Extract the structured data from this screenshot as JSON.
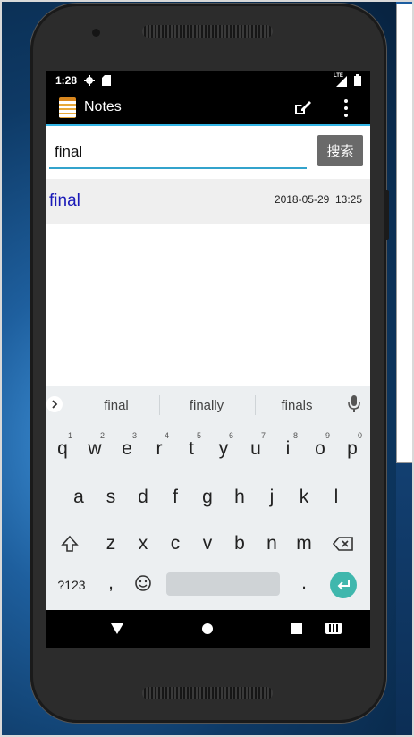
{
  "status_bar": {
    "time": "1:28",
    "network_label": "LTE",
    "icons": [
      "gear-icon",
      "sd-card-icon",
      "signal-icon",
      "battery-icon"
    ]
  },
  "action_bar": {
    "title": "Notes",
    "icons": [
      "notes-app-icon",
      "edit-note-icon",
      "overflow-menu-icon"
    ],
    "accent_color": "#33b5e5"
  },
  "search": {
    "value": "final",
    "button_label": "搜索"
  },
  "notes_list": [
    {
      "title": "final",
      "date": "2018-05-29",
      "time": "13:25"
    }
  ],
  "keyboard": {
    "suggestions": [
      "final",
      "finally",
      "finals"
    ],
    "row1": [
      {
        "key": "q",
        "hint": "1"
      },
      {
        "key": "w",
        "hint": "2"
      },
      {
        "key": "e",
        "hint": "3"
      },
      {
        "key": "r",
        "hint": "4"
      },
      {
        "key": "t",
        "hint": "5"
      },
      {
        "key": "y",
        "hint": "6"
      },
      {
        "key": "u",
        "hint": "7"
      },
      {
        "key": "i",
        "hint": "8"
      },
      {
        "key": "o",
        "hint": "9"
      },
      {
        "key": "p",
        "hint": "0"
      }
    ],
    "row2": [
      "a",
      "s",
      "d",
      "f",
      "g",
      "h",
      "j",
      "k",
      "l"
    ],
    "row3": [
      "z",
      "x",
      "c",
      "v",
      "b",
      "n",
      "m"
    ],
    "symbols_label": "?123",
    "comma": ",",
    "period": ".",
    "enter_color": "#3fb7ad"
  },
  "nav_bar": {
    "icons": [
      "back-icon",
      "home-icon",
      "recents-icon",
      "keyboard-switch-icon"
    ]
  }
}
